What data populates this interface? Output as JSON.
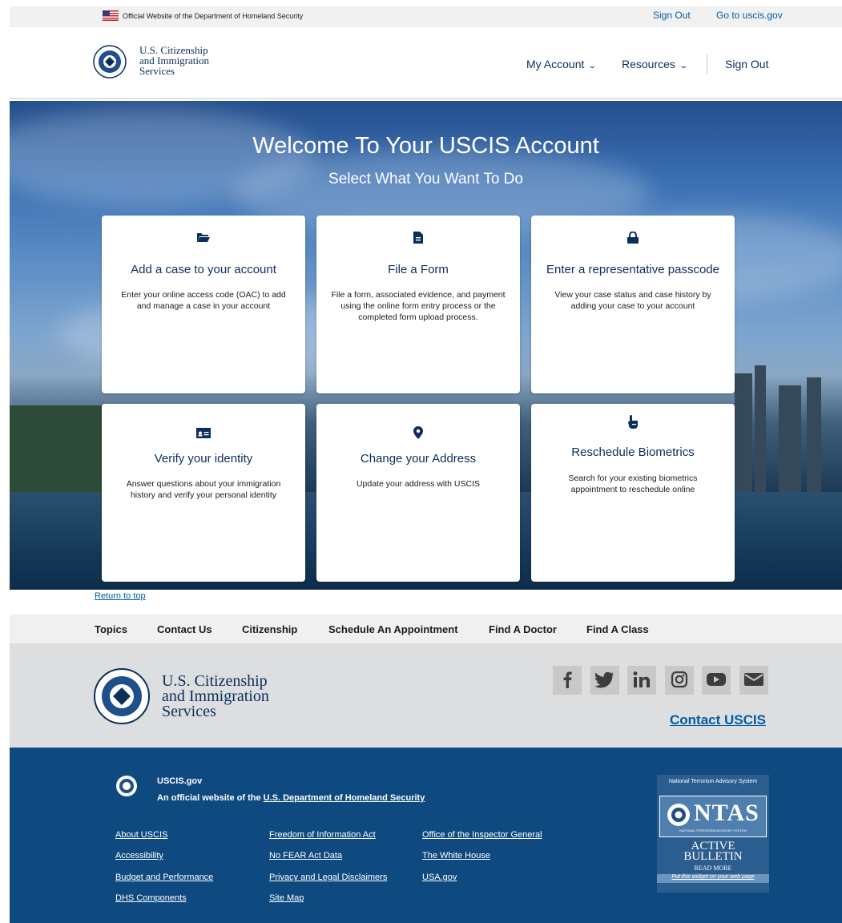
{
  "gov_banner": {
    "official_text": "Official Website of the Department of Homeland Security",
    "sign_out": "Sign Out",
    "go_to": "Go to uscis.gov"
  },
  "header": {
    "logo_lines": [
      "U.S. Citizenship",
      "and Immigration",
      "Services"
    ],
    "nav": {
      "my_account": "My Account",
      "resources": "Resources",
      "sign_out": "Sign Out"
    }
  },
  "hero": {
    "title": "Welcome To Your USCIS Account",
    "subtitle": "Select What You Want To Do",
    "cards": [
      {
        "icon": "folder-open-icon",
        "title": "Add a case to your account",
        "desc": "Enter your online access code (OAC) to add and manage a case in your account"
      },
      {
        "icon": "file-icon",
        "title": "File a Form",
        "desc": "File a form, associated evidence, and payment using the online form entry process or the completed form upload process."
      },
      {
        "icon": "lock-icon",
        "title": "Enter a representative passcode",
        "desc": "View your case status and case history by adding your case to your account"
      },
      {
        "icon": "id-card-icon",
        "title": "Verify your identity",
        "desc": "Answer questions about your immigration history and verify your personal identity"
      },
      {
        "icon": "map-pin-icon",
        "title": "Change your Address",
        "desc": "Update your address with USCIS"
      },
      {
        "icon": "hand-pointer-icon",
        "title": "Reschedule Biometrics",
        "desc": "Search for your existing biometrics appointment to reschedule online"
      }
    ]
  },
  "return_to_top": "Return to top",
  "footer_nav": [
    "Topics",
    "Contact Us",
    "Citizenship",
    "Schedule An Appointment",
    "Find A Doctor",
    "Find A Class"
  ],
  "footer_identity": {
    "logo_lines": [
      "U.S. Citizenship",
      "and Immigration",
      "Services"
    ],
    "social": [
      "facebook-icon",
      "twitter-icon",
      "linkedin-icon",
      "instagram-icon",
      "youtube-icon",
      "email-icon"
    ],
    "contact": "Contact USCIS"
  },
  "footer_bottom": {
    "site": "USCIS.gov",
    "official_prefix": "An official website of the ",
    "official_link": "U.S. Department of Homeland Security",
    "links": [
      "About USCIS",
      "Accessibility",
      "Budget and Performance",
      "DHS Components",
      "Freedom of Information Act",
      "No FEAR Act Data",
      "Privacy and Legal Disclaimers",
      "Site Map",
      "Office of the Inspector General",
      "The White House",
      "USA.gov"
    ],
    "ntas": {
      "head": "National Terrorism Advisory System",
      "logo": "NTAS",
      "logo_sub": "NATIONAL TERRORISM ADVISORY SYSTEM",
      "active": "ACTIVE",
      "bulletin": "BULLETIN",
      "read_more": "READ MORE",
      "widget": "Put this widget on your web page"
    }
  },
  "colors": {
    "brand_navy": "#0b2f5b",
    "link_blue": "#005ea2",
    "footer_blue": "#0e4a80"
  }
}
